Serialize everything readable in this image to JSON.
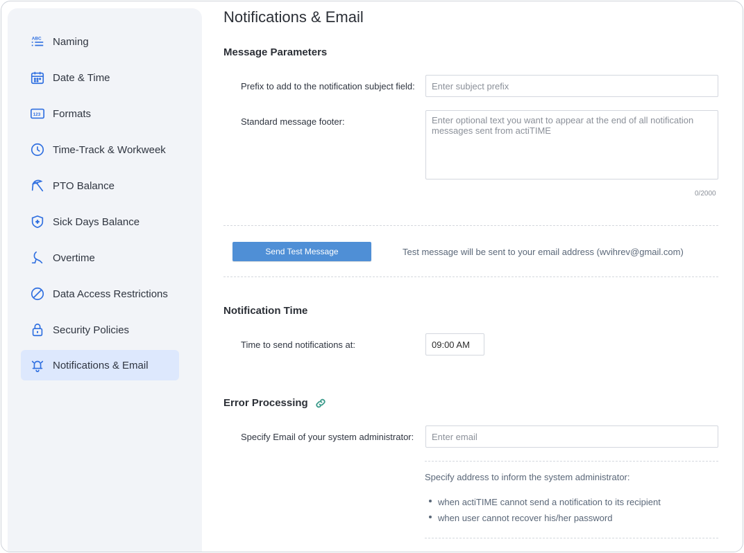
{
  "sidebar": {
    "items": [
      {
        "label": "Naming",
        "icon": "abc-list-icon"
      },
      {
        "label": "Date & Time",
        "icon": "calendar-icon"
      },
      {
        "label": "Formats",
        "icon": "123-icon"
      },
      {
        "label": "Time-Track & Workweek",
        "icon": "clock-icon"
      },
      {
        "label": "PTO Balance",
        "icon": "beach-umbrella-icon"
      },
      {
        "label": "Sick Days Balance",
        "icon": "shield-cross-icon"
      },
      {
        "label": "Overtime",
        "icon": "moon-person-icon"
      },
      {
        "label": "Data Access Restrictions",
        "icon": "prohibited-icon"
      },
      {
        "label": "Security Policies",
        "icon": "lock-icon"
      },
      {
        "label": "Notifications & Email",
        "icon": "bell-icon",
        "active": true
      }
    ]
  },
  "main": {
    "title": "Notifications & Email",
    "message_parameters": {
      "heading": "Message Parameters",
      "prefix_label": "Prefix to add to the notification subject field:",
      "prefix_placeholder": "Enter subject prefix",
      "prefix_value": "",
      "footer_label": "Standard message footer:",
      "footer_placeholder": "Enter optional text you want to appear at the end of all notification messages sent from actiTIME",
      "footer_value": "",
      "footer_counter": "0/2000"
    },
    "test_message": {
      "button_label": "Send Test Message",
      "info": "Test message will be sent to your email address (wvihrev@gmail.com)"
    },
    "notification_time": {
      "heading": "Notification Time",
      "label": "Time to send notifications at:",
      "value": "09:00 AM"
    },
    "error_processing": {
      "heading": "Error Processing",
      "email_label": "Specify Email of your system administrator:",
      "email_placeholder": "Enter email",
      "email_value": "",
      "info_heading": "Specify address to inform the system administrator:",
      "bullets": [
        "when actiTIME cannot send a notification to its recipient",
        "when user cannot recover his/her password"
      ]
    }
  },
  "colors": {
    "accent": "#2f6fe0",
    "button": "#4f8fd6",
    "sidebar_bg": "#f2f4f8",
    "active_bg": "#dde8fd",
    "link_icon": "#3a9a8a"
  }
}
